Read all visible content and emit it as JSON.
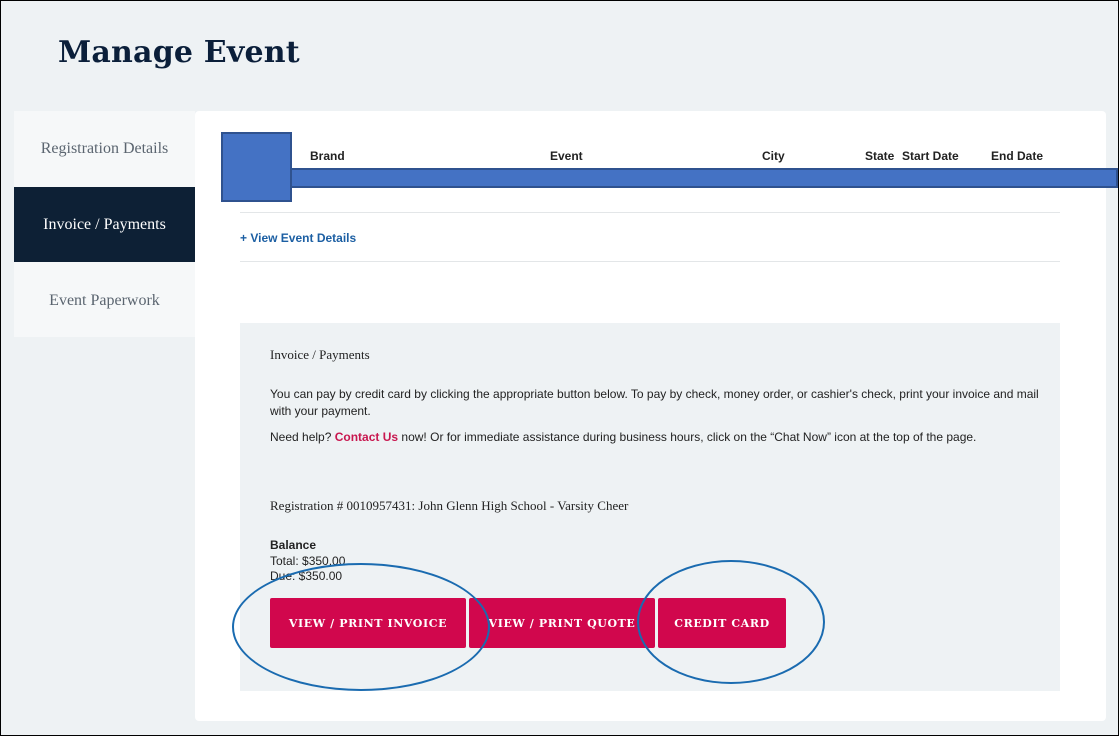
{
  "page": {
    "title": "Manage Event"
  },
  "sidebar": {
    "items": [
      {
        "label": "Registration Details",
        "active": false
      },
      {
        "label": "Invoice / Payments",
        "active": true
      },
      {
        "label": "Event Paperwork",
        "active": false
      }
    ]
  },
  "event_table": {
    "columns": [
      "Brand",
      "Event",
      "City",
      "State",
      "Start Date",
      "End Date"
    ],
    "view_details_link": "+ View Event Details"
  },
  "payments": {
    "heading": "Invoice / Payments",
    "instructions": "You can pay by credit card by clicking the appropriate button below. To pay by check, money order, or cashier's check, print your invoice and mail with your payment.",
    "help_prefix": "Need help?",
    "help_link": "Contact Us",
    "help_suffix": "now! Or for immediate assistance during business hours, click on the “Chat Now” icon at the top of the page.",
    "registration": "Registration # 0010957431: John Glenn High School - Varsity Cheer",
    "balance_label": "Balance",
    "total": "Total: $350.00",
    "due": "Due: $350.00",
    "buttons": {
      "print_invoice": "View / Print Invoice",
      "print_quote": "View / Print Quote",
      "credit_card": "Credit Card"
    }
  },
  "colors": {
    "accent": "#d1074d",
    "nav_active": "#0d2035",
    "link": "#1c5fa3",
    "annotation": "#1a6bb0"
  }
}
